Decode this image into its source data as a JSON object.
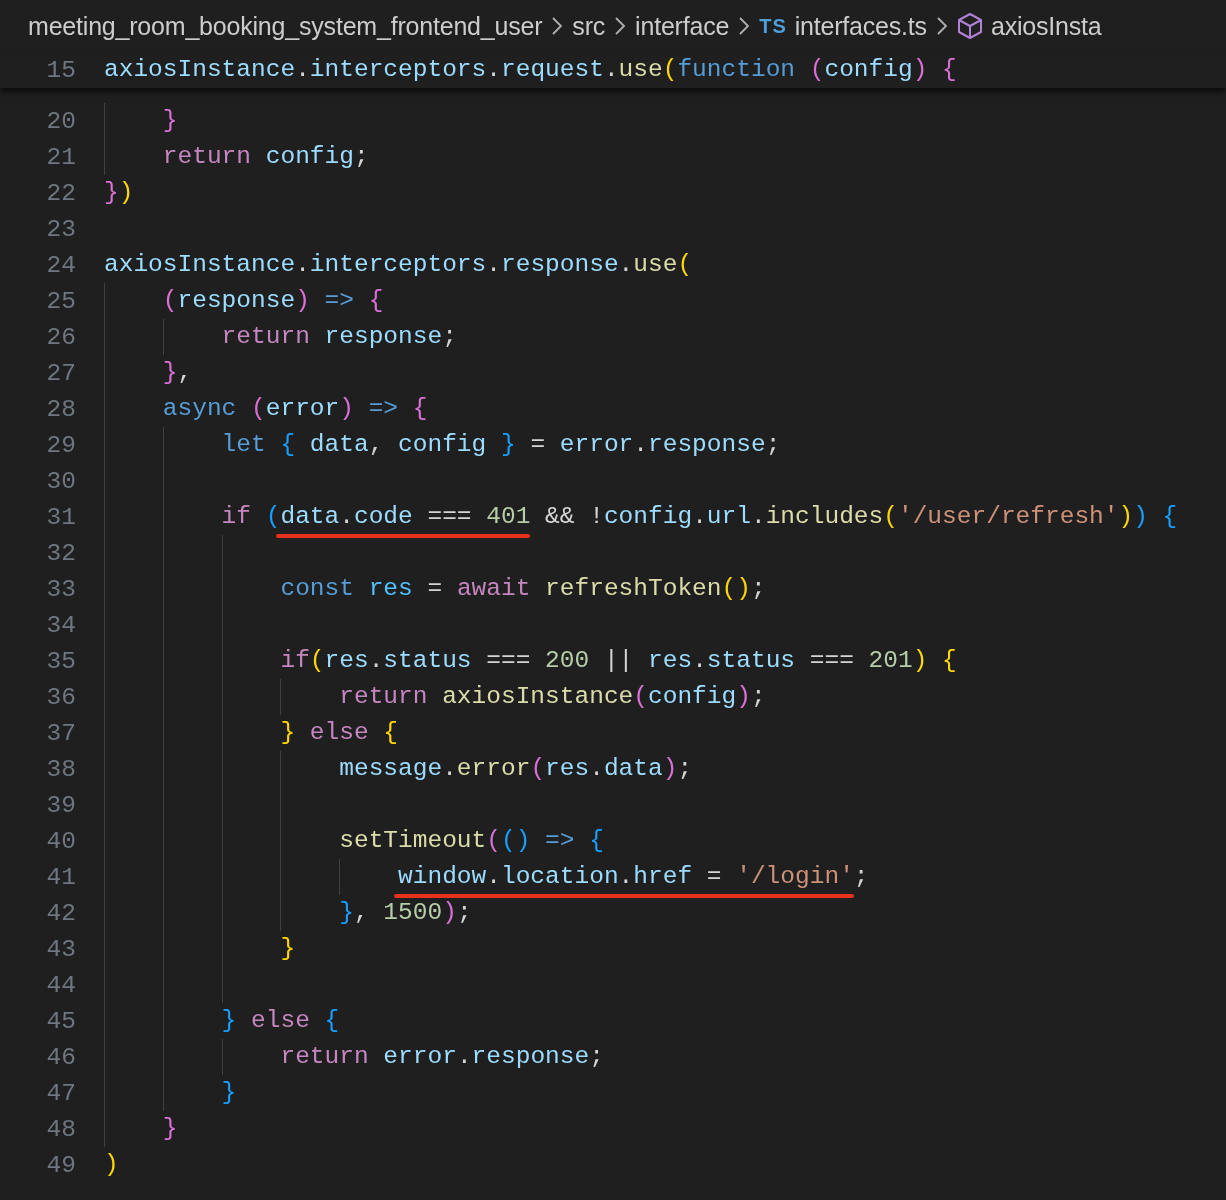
{
  "breadcrumb": [
    {
      "kind": "folder",
      "label": "meeting_room_booking_system_frontend_user"
    },
    {
      "kind": "folder",
      "label": "src"
    },
    {
      "kind": "folder",
      "label": "interface"
    },
    {
      "kind": "file",
      "badge": "TS",
      "label": "interfaces.ts"
    },
    {
      "kind": "symbol",
      "label": "axiosInsta"
    }
  ],
  "sticky_line": {
    "number": "15",
    "tokens": [
      {
        "kind": "var",
        "text": "axiosInstance"
      },
      {
        "kind": "plain",
        "text": "."
      },
      {
        "kind": "var",
        "text": "interceptors"
      },
      {
        "kind": "plain",
        "text": "."
      },
      {
        "kind": "var",
        "text": "request"
      },
      {
        "kind": "plain",
        "text": "."
      },
      {
        "kind": "fn",
        "text": "use"
      },
      {
        "kind": "b1",
        "text": "("
      },
      {
        "kind": "kw",
        "text": "function "
      },
      {
        "kind": "b2",
        "text": "("
      },
      {
        "kind": "var",
        "text": "config"
      },
      {
        "kind": "b2",
        "text": ") {"
      }
    ]
  },
  "lines": [
    {
      "number": "20",
      "tokens": [
        {
          "kind": "b2",
          "text": "    }"
        }
      ]
    },
    {
      "number": "21",
      "tokens": [
        {
          "kind": "ctl",
          "text": "    return "
        },
        {
          "kind": "var",
          "text": "config"
        },
        {
          "kind": "plain",
          "text": ";"
        }
      ]
    },
    {
      "number": "22",
      "tokens": [
        {
          "kind": "b2",
          "text": "}"
        },
        {
          "kind": "b1",
          "text": ")"
        }
      ]
    },
    {
      "number": "23"
    },
    {
      "number": "24",
      "tokens": [
        {
          "kind": "var",
          "text": "axiosInstance"
        },
        {
          "kind": "plain",
          "text": "."
        },
        {
          "kind": "var",
          "text": "interceptors"
        },
        {
          "kind": "plain",
          "text": "."
        },
        {
          "kind": "var",
          "text": "response"
        },
        {
          "kind": "plain",
          "text": "."
        },
        {
          "kind": "fn",
          "text": "use"
        },
        {
          "kind": "b1",
          "text": "("
        }
      ]
    },
    {
      "number": "25",
      "tokens": [
        {
          "kind": "b2",
          "text": "    ("
        },
        {
          "kind": "var",
          "text": "response"
        },
        {
          "kind": "b2",
          "text": ") "
        },
        {
          "kind": "kw",
          "text": "=> "
        },
        {
          "kind": "b2",
          "text": "{"
        }
      ]
    },
    {
      "number": "26",
      "tokens": [
        {
          "kind": "ctl",
          "text": "        return "
        },
        {
          "kind": "var",
          "text": "response"
        },
        {
          "kind": "plain",
          "text": ";"
        }
      ]
    },
    {
      "number": "27",
      "tokens": [
        {
          "kind": "b2",
          "text": "    }"
        },
        {
          "kind": "plain",
          "text": ","
        }
      ]
    },
    {
      "number": "28",
      "tokens": [
        {
          "kind": "kw",
          "text": "    async "
        },
        {
          "kind": "b2",
          "text": "("
        },
        {
          "kind": "var",
          "text": "error"
        },
        {
          "kind": "b2",
          "text": ") "
        },
        {
          "kind": "kw",
          "text": "=> "
        },
        {
          "kind": "b2",
          "text": "{"
        }
      ]
    },
    {
      "number": "29",
      "tokens": [
        {
          "kind": "kw",
          "text": "        let "
        },
        {
          "kind": "b3",
          "text": "{ "
        },
        {
          "kind": "var",
          "text": "data"
        },
        {
          "kind": "plain",
          "text": ", "
        },
        {
          "kind": "var",
          "text": "config "
        },
        {
          "kind": "b3",
          "text": "}"
        },
        {
          "kind": "plain",
          "text": " = "
        },
        {
          "kind": "var",
          "text": "error"
        },
        {
          "kind": "plain",
          "text": "."
        },
        {
          "kind": "var",
          "text": "response"
        },
        {
          "kind": "plain",
          "text": ";"
        }
      ]
    },
    {
      "number": "30"
    },
    {
      "number": "31",
      "tokens": [
        {
          "kind": "ctl",
          "text": "        if "
        },
        {
          "kind": "b3",
          "text": "("
        },
        {
          "kind": "underline",
          "tokens": [
            {
              "kind": "var",
              "text": "data"
            },
            {
              "kind": "plain",
              "text": "."
            },
            {
              "kind": "var",
              "text": "code"
            },
            {
              "kind": "plain",
              "text": " === "
            },
            {
              "kind": "num",
              "text": "401"
            }
          ]
        },
        {
          "kind": "plain",
          "text": " && !"
        },
        {
          "kind": "var",
          "text": "config"
        },
        {
          "kind": "plain",
          "text": "."
        },
        {
          "kind": "var",
          "text": "url"
        },
        {
          "kind": "plain",
          "text": "."
        },
        {
          "kind": "fn",
          "text": "includes"
        },
        {
          "kind": "b1",
          "text": "("
        },
        {
          "kind": "str",
          "text": "'/user/refresh'"
        },
        {
          "kind": "b1",
          "text": ")"
        },
        {
          "kind": "b3",
          "text": ") {"
        }
      ]
    },
    {
      "number": "32"
    },
    {
      "number": "33",
      "tokens": [
        {
          "kind": "kw",
          "text": "            const "
        },
        {
          "kind": "const",
          "text": "res"
        },
        {
          "kind": "plain",
          "text": " = "
        },
        {
          "kind": "ctl",
          "text": "await "
        },
        {
          "kind": "fn",
          "text": "refreshToken"
        },
        {
          "kind": "b1",
          "text": "()"
        },
        {
          "kind": "plain",
          "text": ";"
        }
      ]
    },
    {
      "number": "34"
    },
    {
      "number": "35",
      "tokens": [
        {
          "kind": "ctl",
          "text": "            if"
        },
        {
          "kind": "b1",
          "text": "("
        },
        {
          "kind": "var",
          "text": "res"
        },
        {
          "kind": "plain",
          "text": "."
        },
        {
          "kind": "var",
          "text": "status"
        },
        {
          "kind": "plain",
          "text": " === "
        },
        {
          "kind": "num",
          "text": "200"
        },
        {
          "kind": "plain",
          "text": " || "
        },
        {
          "kind": "var",
          "text": "res"
        },
        {
          "kind": "plain",
          "text": "."
        },
        {
          "kind": "var",
          "text": "status"
        },
        {
          "kind": "plain",
          "text": " === "
        },
        {
          "kind": "num",
          "text": "201"
        },
        {
          "kind": "b1",
          "text": ") {"
        }
      ]
    },
    {
      "number": "36",
      "tokens": [
        {
          "kind": "ctl",
          "text": "                return "
        },
        {
          "kind": "fn",
          "text": "axiosInstance"
        },
        {
          "kind": "b2",
          "text": "("
        },
        {
          "kind": "var",
          "text": "config"
        },
        {
          "kind": "b2",
          "text": ")"
        },
        {
          "kind": "plain",
          "text": ";"
        }
      ]
    },
    {
      "number": "37",
      "tokens": [
        {
          "kind": "b1",
          "text": "            } "
        },
        {
          "kind": "ctl",
          "text": "else "
        },
        {
          "kind": "b1",
          "text": "{"
        }
      ]
    },
    {
      "number": "38",
      "tokens": [
        {
          "kind": "var",
          "text": "                message"
        },
        {
          "kind": "plain",
          "text": "."
        },
        {
          "kind": "fn",
          "text": "error"
        },
        {
          "kind": "b2",
          "text": "("
        },
        {
          "kind": "var",
          "text": "res"
        },
        {
          "kind": "plain",
          "text": "."
        },
        {
          "kind": "var",
          "text": "data"
        },
        {
          "kind": "b2",
          "text": ")"
        },
        {
          "kind": "plain",
          "text": ";"
        }
      ]
    },
    {
      "number": "39"
    },
    {
      "number": "40",
      "tokens": [
        {
          "kind": "fn",
          "text": "                setTimeout"
        },
        {
          "kind": "b2",
          "text": "("
        },
        {
          "kind": "b3",
          "text": "() "
        },
        {
          "kind": "kw",
          "text": "=> "
        },
        {
          "kind": "b3",
          "text": "{"
        }
      ]
    },
    {
      "number": "41",
      "tokens": [
        {
          "kind": "underline",
          "tokens": [
            {
              "kind": "var",
              "text": "                    window"
            },
            {
              "kind": "plain",
              "text": "."
            },
            {
              "kind": "var",
              "text": "location"
            },
            {
              "kind": "plain",
              "text": "."
            },
            {
              "kind": "var",
              "text": "href"
            },
            {
              "kind": "plain",
              "text": " = "
            },
            {
              "kind": "str",
              "text": "'/login'"
            }
          ]
        },
        {
          "kind": "plain",
          "text": ";"
        }
      ]
    },
    {
      "number": "42",
      "tokens": [
        {
          "kind": "b3",
          "text": "                }"
        },
        {
          "kind": "plain",
          "text": ", "
        },
        {
          "kind": "num",
          "text": "1500"
        },
        {
          "kind": "b2",
          "text": ")"
        },
        {
          "kind": "plain",
          "text": ";"
        }
      ]
    },
    {
      "number": "43",
      "tokens": [
        {
          "kind": "b1",
          "text": "            }"
        }
      ]
    },
    {
      "number": "44"
    },
    {
      "number": "45",
      "tokens": [
        {
          "kind": "b3",
          "text": "        } "
        },
        {
          "kind": "ctl",
          "text": "else "
        },
        {
          "kind": "b3",
          "text": "{"
        }
      ]
    },
    {
      "number": "46",
      "tokens": [
        {
          "kind": "ctl",
          "text": "            return "
        },
        {
          "kind": "var",
          "text": "error"
        },
        {
          "kind": "plain",
          "text": "."
        },
        {
          "kind": "var",
          "text": "response"
        },
        {
          "kind": "plain",
          "text": ";"
        }
      ]
    },
    {
      "number": "47",
      "tokens": [
        {
          "kind": "b3",
          "text": "        }"
        }
      ]
    },
    {
      "number": "48",
      "tokens": [
        {
          "kind": "b2",
          "text": "    }"
        }
      ]
    },
    {
      "number": "49",
      "tokens": [
        {
          "kind": "b1",
          "text": ")"
        }
      ]
    }
  ]
}
